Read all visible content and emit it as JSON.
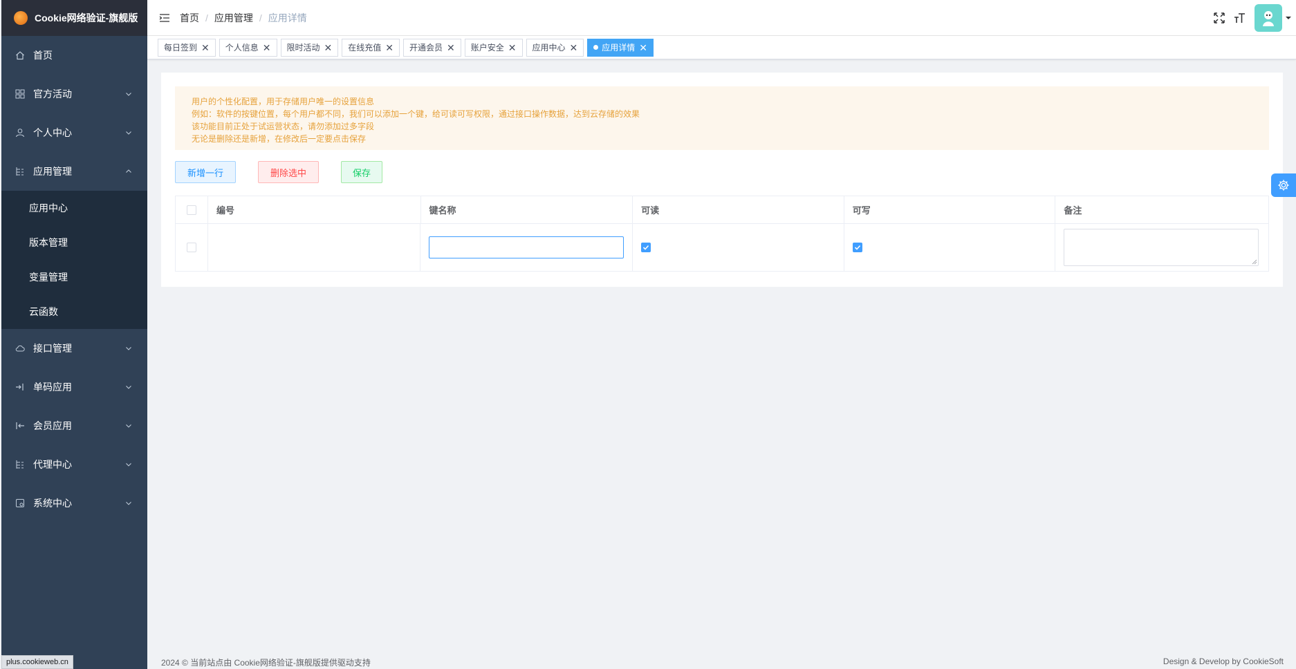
{
  "app": {
    "title": "Cookie网络验证-旗舰版",
    "logo_icon": "fire-logo-icon"
  },
  "sidebar": {
    "items": [
      {
        "label": "首页",
        "icon": "home-icon"
      },
      {
        "label": "官方活动",
        "icon": "grid-icon",
        "expandable": true
      },
      {
        "label": "个人中心",
        "icon": "user-icon",
        "expandable": true
      },
      {
        "label": "应用管理",
        "icon": "tree-icon",
        "expandable": true,
        "expanded": true
      },
      {
        "label": "接口管理",
        "icon": "cloud-icon",
        "expandable": true
      },
      {
        "label": "单码应用",
        "icon": "login-icon",
        "expandable": true
      },
      {
        "label": "会员应用",
        "icon": "logout-icon",
        "expandable": true
      },
      {
        "label": "代理中心",
        "icon": "tree-icon",
        "expandable": true
      },
      {
        "label": "系统中心",
        "icon": "monitor-icon",
        "expandable": true
      }
    ],
    "submenu": [
      "应用中心",
      "版本管理",
      "变量管理",
      "云函数"
    ]
  },
  "header": {
    "breadcrumb": [
      "首页",
      "应用管理",
      "应用详情"
    ],
    "icons": [
      "fullscreen-icon",
      "font-size-icon"
    ],
    "avatar_icon": "avatar-icon"
  },
  "tags": [
    {
      "label": "每日签到",
      "active": false
    },
    {
      "label": "个人信息",
      "active": false
    },
    {
      "label": "限时活动",
      "active": false
    },
    {
      "label": "在线充值",
      "active": false
    },
    {
      "label": "开通会员",
      "active": false
    },
    {
      "label": "账户安全",
      "active": false
    },
    {
      "label": "应用中心",
      "active": false
    },
    {
      "label": "应用详情",
      "active": true
    }
  ],
  "alert": {
    "lines": [
      "用户的个性化配置，用于存储用户唯一的设置信息",
      "例如：软件的按键位置，每个用户都不同，我们可以添加一个键，给可读可写权限，通过接口操作数据，达到云存储的效果",
      "该功能目前正处于试运营状态，请勿添加过多字段",
      "无论是删除还是新增，在修改后一定要点击保存"
    ]
  },
  "toolbar": {
    "add_label": "新增一行",
    "delete_label": "删除选中",
    "save_label": "保存"
  },
  "table": {
    "headers": [
      "编号",
      "键名称",
      "可读",
      "可写",
      "备注"
    ],
    "rows": [
      {
        "selected": false,
        "id": "",
        "key_name": "",
        "readable": true,
        "writable": true,
        "remark": ""
      }
    ]
  },
  "footer": {
    "left": "2024 © 当前站点由 Cookie网络验证-旗舰版提供驱动支持",
    "right": "Design & Develop by CookieSoft"
  },
  "status_bar": {
    "url": "plus.cookieweb.cn"
  },
  "colors": {
    "sidebar_bg": "#304156",
    "submenu_bg": "#1f2d3d",
    "primary": "#409eff",
    "warning_text": "#e6a23c",
    "avatar_bg": "#6ad7cf"
  }
}
